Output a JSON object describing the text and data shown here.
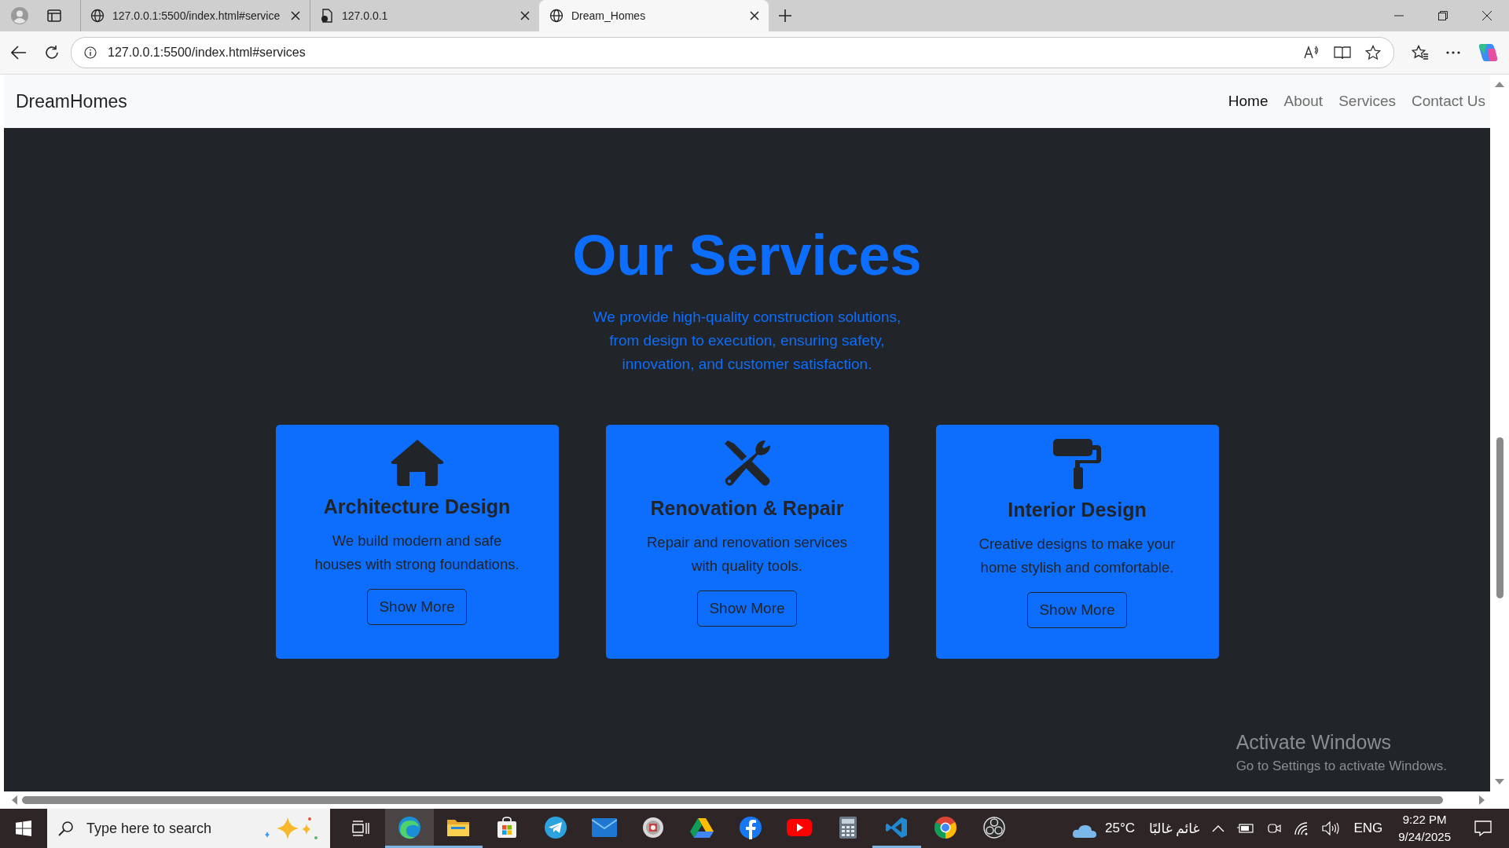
{
  "browser": {
    "tabs": [
      {
        "kind": "globe",
        "title": "127.0.0.1:5500/index.html#service",
        "selected": false
      },
      {
        "kind": "file",
        "title": "127.0.0.1",
        "selected": false
      },
      {
        "kind": "globe",
        "title": "Dream_Homes",
        "selected": true
      }
    ],
    "address": "127.0.0.1:5500/index.html#services"
  },
  "navbar": {
    "brand": "DreamHomes",
    "links": [
      {
        "label": "Home",
        "selected": true
      },
      {
        "label": "About",
        "selected": false
      },
      {
        "label": "Services",
        "selected": false
      },
      {
        "label": "Contact Us",
        "selected": false
      }
    ]
  },
  "services": {
    "title": "Our Services",
    "lines": [
      "We provide high-quality construction solutions,",
      "from design to execution, ensuring safety,",
      "innovation, and customer satisfaction."
    ],
    "cards": [
      {
        "kind": "house",
        "title": "Architecture Design",
        "text": [
          "We build modern and safe",
          "houses with strong foundations."
        ],
        "button": "Show More"
      },
      {
        "kind": "tools",
        "title": "Renovation & Repair",
        "text": [
          "Repair and renovation services",
          "with quality tools."
        ],
        "button": "Show More"
      },
      {
        "kind": "roller",
        "title": "Interior Design",
        "text": [
          "Creative designs to make your",
          "home stylish and comfortable."
        ],
        "button": "Show More"
      }
    ]
  },
  "activation": {
    "title": "Activate Windows",
    "text": "Go to Settings to activate Windows."
  },
  "taskbar": {
    "search": {
      "placeholder": "Type here to search"
    },
    "apps": [
      {
        "kind": "edge",
        "selected": true,
        "running": true
      },
      {
        "kind": "folder",
        "selected": false,
        "running": true
      },
      {
        "kind": "store",
        "selected": false,
        "running": false
      },
      {
        "kind": "telegram",
        "selected": false,
        "running": false
      },
      {
        "kind": "mail",
        "selected": false,
        "running": false
      },
      {
        "kind": "disc",
        "selected": false,
        "running": false
      },
      {
        "kind": "drive",
        "selected": false,
        "running": false
      },
      {
        "kind": "facebook",
        "selected": false,
        "running": false
      },
      {
        "kind": "youtube",
        "selected": false,
        "running": false
      },
      {
        "kind": "calculator",
        "selected": false,
        "running": false
      },
      {
        "kind": "vscode",
        "selected": false,
        "running": true
      },
      {
        "kind": "chrome",
        "selected": false,
        "running": false
      },
      {
        "kind": "obs",
        "selected": false,
        "running": false
      }
    ],
    "weather": {
      "temperature": "25°C",
      "condition": "غائم غالبًا"
    },
    "language": "ENG",
    "time": "9:22 PM",
    "date": "9/24/2025"
  }
}
